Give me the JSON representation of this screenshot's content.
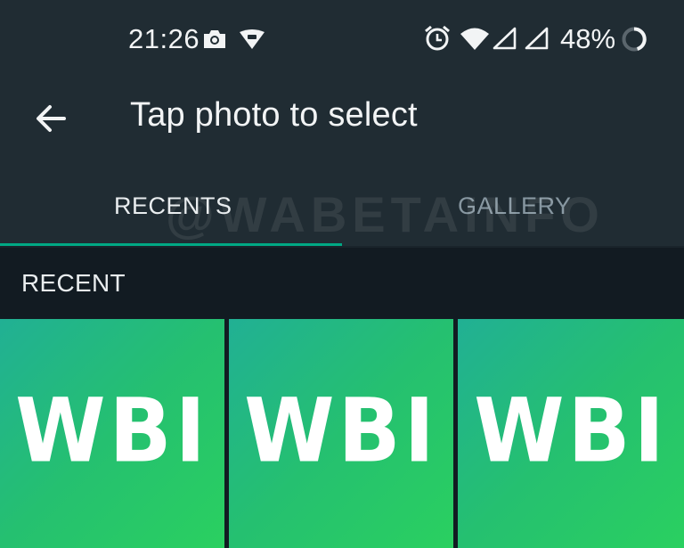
{
  "status_bar": {
    "time": "21:26",
    "battery": "48%",
    "icons": [
      "camera-icon",
      "vpn-shield-icon",
      "alarm-icon",
      "wifi-icon",
      "cell-signal-icon",
      "cell-signal-icon",
      "battery-ring-icon"
    ]
  },
  "app_bar": {
    "title": "Tap photo to select",
    "back_icon": "arrow-left-icon"
  },
  "tabs": [
    {
      "label": "RECENTS",
      "selected": true
    },
    {
      "label": "GALLERY",
      "selected": false
    }
  ],
  "watermark": "@WABETAINFO",
  "section": {
    "label": "RECENT"
  },
  "thumbnails": [
    {
      "text": "WBI"
    },
    {
      "text": "WBI"
    },
    {
      "text": "WBI"
    }
  ],
  "colors": {
    "bar_bg": "#202c33",
    "page_bg": "#121b22",
    "accent": "#00a884",
    "thumb_green": "#25c070"
  }
}
